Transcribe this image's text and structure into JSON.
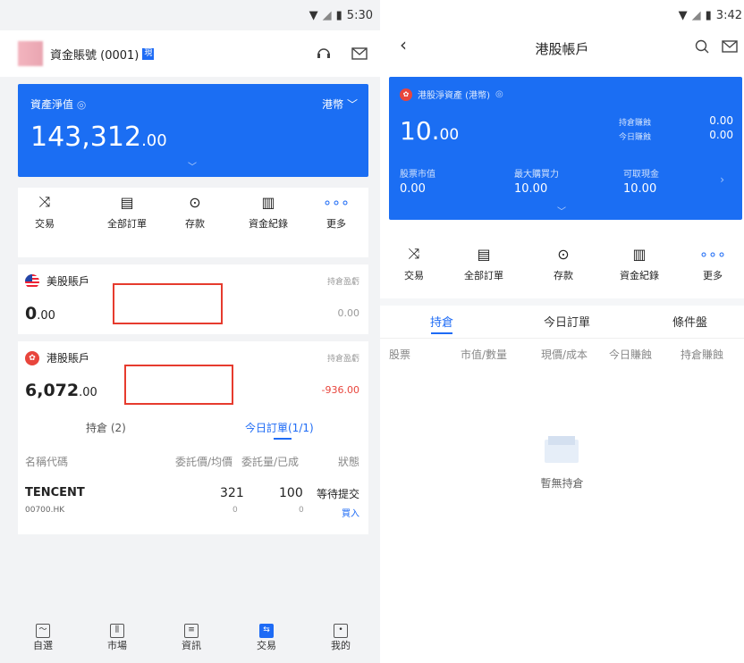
{
  "left": {
    "status": {
      "time": "5:30"
    },
    "header": {
      "account": "資金賬號 (0001)",
      "badge": "現"
    },
    "asset": {
      "label": "資產淨值",
      "currency": "港幣",
      "value_main": "143,312",
      "value_dec": ".00"
    },
    "actions": [
      {
        "label": "交易",
        "icon": "shuffle-icon"
      },
      {
        "label": "全部訂單",
        "icon": "document-icon"
      },
      {
        "label": "存款",
        "icon": "deposit-icon"
      },
      {
        "label": "資金紀錄",
        "icon": "record-icon"
      },
      {
        "label": "更多",
        "icon": "more-icon"
      }
    ],
    "us": {
      "name": "美股賬戶",
      "link": "持倉盈虧",
      "value_main": "0",
      "value_dec": ".00",
      "pl": "0.00"
    },
    "hk": {
      "name": "港股賬戶",
      "link": "持倉盈虧",
      "value_main": "6,072",
      "value_dec": ".00",
      "pl": "-936.00",
      "tabs": [
        "持倉 (2)",
        "今日訂單(1/1)"
      ],
      "columns": [
        "名稱代碼",
        "委託價/均價",
        "委託量/已成",
        "狀態"
      ],
      "order": {
        "name": "TENCENT",
        "code": "00700.HK",
        "price": "321",
        "price_sub": "0",
        "qty": "100",
        "qty_sub": "0",
        "status": "等待提交",
        "side": "買入"
      }
    },
    "nav": [
      {
        "label": "自選",
        "icon": "chart-icon"
      },
      {
        "label": "市場",
        "icon": "bars-icon"
      },
      {
        "label": "資訊",
        "icon": "news-icon"
      },
      {
        "label": "交易",
        "icon": "trade-icon"
      },
      {
        "label": "我的",
        "icon": "profile-icon"
      }
    ]
  },
  "right": {
    "status": {
      "time": "3:42"
    },
    "title": "港股帳戶",
    "card": {
      "label": "港股淨資產 (港幣)",
      "value_main": "10.",
      "value_dec": "00",
      "hold_pl_label": "持倉賺蝕",
      "hold_pl": "0.00",
      "today_pl_label": "今日賺蝕",
      "today_pl": "0.00",
      "stats": [
        {
          "label": "股票市值",
          "value": "0.00"
        },
        {
          "label": "最大購買力",
          "value": "10.00"
        },
        {
          "label": "可取現金",
          "value": "10.00"
        }
      ]
    },
    "actions": [
      {
        "label": "交易",
        "icon": "shuffle-icon"
      },
      {
        "label": "全部訂單",
        "icon": "document-icon"
      },
      {
        "label": "存款",
        "icon": "deposit-icon"
      },
      {
        "label": "資金紀錄",
        "icon": "record-icon"
      },
      {
        "label": "更多",
        "icon": "more-icon"
      }
    ],
    "tabs": [
      "持倉",
      "今日訂單",
      "條件盤"
    ],
    "columns": [
      "股票",
      "市值/數量",
      "現價/成本",
      "今日賺蝕",
      "持倉賺蝕"
    ],
    "empty": "暫無持倉"
  }
}
